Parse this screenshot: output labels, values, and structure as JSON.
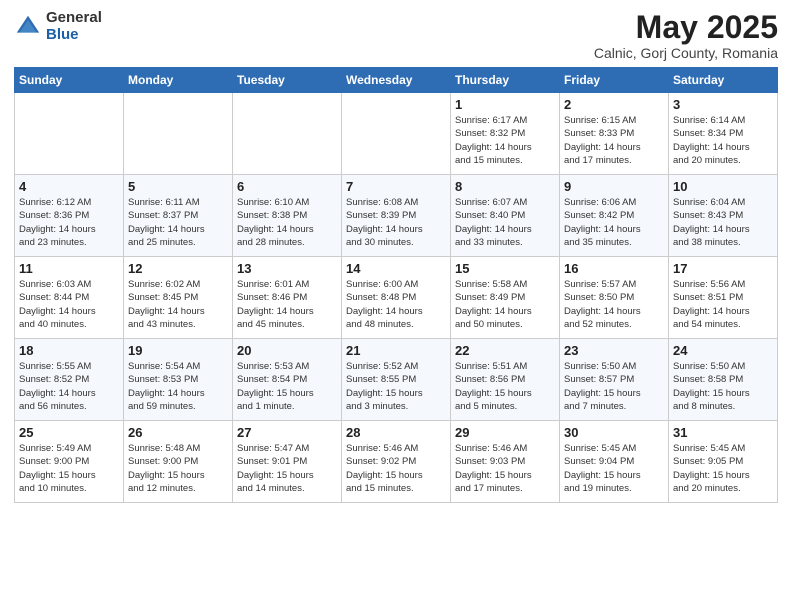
{
  "header": {
    "logo_general": "General",
    "logo_blue": "Blue",
    "month_title": "May 2025",
    "location": "Calnic, Gorj County, Romania"
  },
  "days_of_week": [
    "Sunday",
    "Monday",
    "Tuesday",
    "Wednesday",
    "Thursday",
    "Friday",
    "Saturday"
  ],
  "weeks": [
    [
      {
        "day": "",
        "detail": ""
      },
      {
        "day": "",
        "detail": ""
      },
      {
        "day": "",
        "detail": ""
      },
      {
        "day": "",
        "detail": ""
      },
      {
        "day": "1",
        "detail": "Sunrise: 6:17 AM\nSunset: 8:32 PM\nDaylight: 14 hours\nand 15 minutes."
      },
      {
        "day": "2",
        "detail": "Sunrise: 6:15 AM\nSunset: 8:33 PM\nDaylight: 14 hours\nand 17 minutes."
      },
      {
        "day": "3",
        "detail": "Sunrise: 6:14 AM\nSunset: 8:34 PM\nDaylight: 14 hours\nand 20 minutes."
      }
    ],
    [
      {
        "day": "4",
        "detail": "Sunrise: 6:12 AM\nSunset: 8:36 PM\nDaylight: 14 hours\nand 23 minutes."
      },
      {
        "day": "5",
        "detail": "Sunrise: 6:11 AM\nSunset: 8:37 PM\nDaylight: 14 hours\nand 25 minutes."
      },
      {
        "day": "6",
        "detail": "Sunrise: 6:10 AM\nSunset: 8:38 PM\nDaylight: 14 hours\nand 28 minutes."
      },
      {
        "day": "7",
        "detail": "Sunrise: 6:08 AM\nSunset: 8:39 PM\nDaylight: 14 hours\nand 30 minutes."
      },
      {
        "day": "8",
        "detail": "Sunrise: 6:07 AM\nSunset: 8:40 PM\nDaylight: 14 hours\nand 33 minutes."
      },
      {
        "day": "9",
        "detail": "Sunrise: 6:06 AM\nSunset: 8:42 PM\nDaylight: 14 hours\nand 35 minutes."
      },
      {
        "day": "10",
        "detail": "Sunrise: 6:04 AM\nSunset: 8:43 PM\nDaylight: 14 hours\nand 38 minutes."
      }
    ],
    [
      {
        "day": "11",
        "detail": "Sunrise: 6:03 AM\nSunset: 8:44 PM\nDaylight: 14 hours\nand 40 minutes."
      },
      {
        "day": "12",
        "detail": "Sunrise: 6:02 AM\nSunset: 8:45 PM\nDaylight: 14 hours\nand 43 minutes."
      },
      {
        "day": "13",
        "detail": "Sunrise: 6:01 AM\nSunset: 8:46 PM\nDaylight: 14 hours\nand 45 minutes."
      },
      {
        "day": "14",
        "detail": "Sunrise: 6:00 AM\nSunset: 8:48 PM\nDaylight: 14 hours\nand 48 minutes."
      },
      {
        "day": "15",
        "detail": "Sunrise: 5:58 AM\nSunset: 8:49 PM\nDaylight: 14 hours\nand 50 minutes."
      },
      {
        "day": "16",
        "detail": "Sunrise: 5:57 AM\nSunset: 8:50 PM\nDaylight: 14 hours\nand 52 minutes."
      },
      {
        "day": "17",
        "detail": "Sunrise: 5:56 AM\nSunset: 8:51 PM\nDaylight: 14 hours\nand 54 minutes."
      }
    ],
    [
      {
        "day": "18",
        "detail": "Sunrise: 5:55 AM\nSunset: 8:52 PM\nDaylight: 14 hours\nand 56 minutes."
      },
      {
        "day": "19",
        "detail": "Sunrise: 5:54 AM\nSunset: 8:53 PM\nDaylight: 14 hours\nand 59 minutes."
      },
      {
        "day": "20",
        "detail": "Sunrise: 5:53 AM\nSunset: 8:54 PM\nDaylight: 15 hours\nand 1 minute."
      },
      {
        "day": "21",
        "detail": "Sunrise: 5:52 AM\nSunset: 8:55 PM\nDaylight: 15 hours\nand 3 minutes."
      },
      {
        "day": "22",
        "detail": "Sunrise: 5:51 AM\nSunset: 8:56 PM\nDaylight: 15 hours\nand 5 minutes."
      },
      {
        "day": "23",
        "detail": "Sunrise: 5:50 AM\nSunset: 8:57 PM\nDaylight: 15 hours\nand 7 minutes."
      },
      {
        "day": "24",
        "detail": "Sunrise: 5:50 AM\nSunset: 8:58 PM\nDaylight: 15 hours\nand 8 minutes."
      }
    ],
    [
      {
        "day": "25",
        "detail": "Sunrise: 5:49 AM\nSunset: 9:00 PM\nDaylight: 15 hours\nand 10 minutes."
      },
      {
        "day": "26",
        "detail": "Sunrise: 5:48 AM\nSunset: 9:00 PM\nDaylight: 15 hours\nand 12 minutes."
      },
      {
        "day": "27",
        "detail": "Sunrise: 5:47 AM\nSunset: 9:01 PM\nDaylight: 15 hours\nand 14 minutes."
      },
      {
        "day": "28",
        "detail": "Sunrise: 5:46 AM\nSunset: 9:02 PM\nDaylight: 15 hours\nand 15 minutes."
      },
      {
        "day": "29",
        "detail": "Sunrise: 5:46 AM\nSunset: 9:03 PM\nDaylight: 15 hours\nand 17 minutes."
      },
      {
        "day": "30",
        "detail": "Sunrise: 5:45 AM\nSunset: 9:04 PM\nDaylight: 15 hours\nand 19 minutes."
      },
      {
        "day": "31",
        "detail": "Sunrise: 5:45 AM\nSunset: 9:05 PM\nDaylight: 15 hours\nand 20 minutes."
      }
    ]
  ]
}
